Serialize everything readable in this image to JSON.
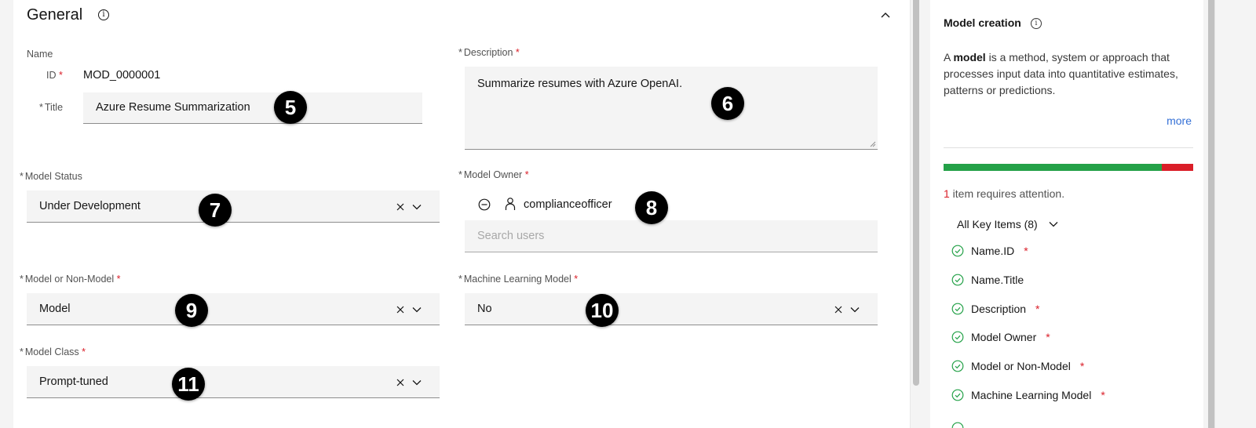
{
  "section": {
    "title": "General",
    "info_icon": "info-icon",
    "collapse_icon": "chevron-up-icon"
  },
  "name_group": {
    "label": "Name",
    "id_label": "ID",
    "id_value": "MOD_0000001",
    "title_label": "Title",
    "title_value": "Azure Resume Summarization"
  },
  "description": {
    "label": "Description",
    "value": "Summarize resumes with Azure OpenAI."
  },
  "model_status": {
    "label": "Model Status",
    "value": "Under Development"
  },
  "model_owner": {
    "label": "Model Owner",
    "selected_user": "complianceofficer",
    "search_placeholder": "Search users"
  },
  "model_or_non_model": {
    "label": "Model or Non-Model",
    "value": "Model"
  },
  "machine_learning_model": {
    "label": "Machine Learning Model",
    "value": "No"
  },
  "model_class": {
    "label": "Model Class",
    "value": "Prompt-tuned"
  },
  "required_marker": "*",
  "badges": [
    "5",
    "6",
    "7",
    "8",
    "9",
    "10",
    "11"
  ],
  "side_panel": {
    "title": "Model creation",
    "desc_prefix": "A ",
    "desc_bold": "model",
    "desc_suffix": " is a method, system or approach that processes input data into quantitative estimates, patterns or predictions.",
    "more_link": "more",
    "progress_complete_fraction": 0.875,
    "progress_colors": {
      "complete": "#24a148",
      "incomplete": "#da1e28"
    },
    "attention_count": "1",
    "attention_text": " item requires attention.",
    "filter_label": "All Key Items (8)",
    "items": [
      {
        "label": "Name.ID",
        "required": true
      },
      {
        "label": "Name.Title",
        "required": false
      },
      {
        "label": "Description",
        "required": true
      },
      {
        "label": "Model Owner",
        "required": true
      },
      {
        "label": "Model or Non-Model",
        "required": true
      },
      {
        "label": "Machine Learning Model",
        "required": true
      }
    ]
  }
}
